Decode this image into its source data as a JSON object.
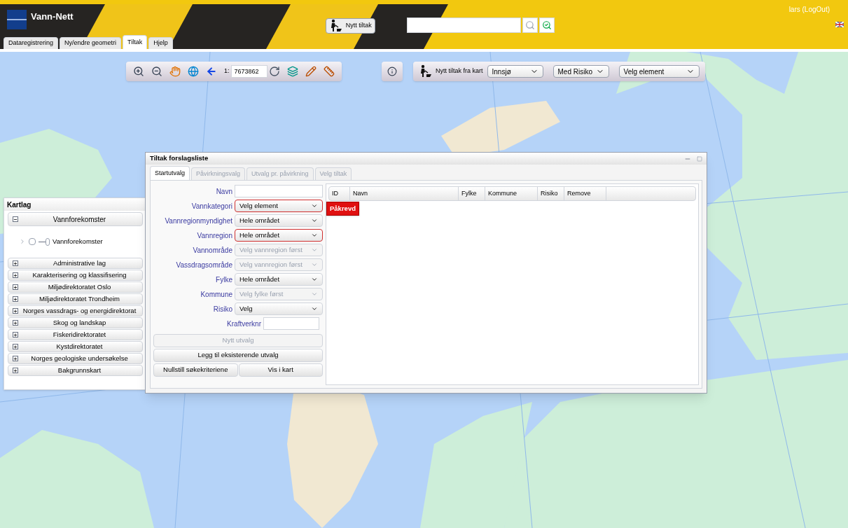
{
  "app": {
    "title": "Vann-Nett"
  },
  "header": {
    "new_measure_button": "Nytt tiltak",
    "user_link": "lars (LogOut)"
  },
  "tabs": [
    {
      "label": "Dataregistrering",
      "selected": false
    },
    {
      "label": "Ny/endre geometri",
      "selected": false
    },
    {
      "label": "Tiltak",
      "selected": true
    },
    {
      "label": "Hjelp",
      "selected": false
    }
  ],
  "map_toolbar": {
    "scale_prefix": "1:",
    "scale": "7673862"
  },
  "measure_toolbar": {
    "button": "Nytt tiltak fra kart",
    "dropdowns": [
      "Innsjø",
      "Med Risiko",
      "Velg element"
    ]
  },
  "layers_panel": {
    "title": "Kartlag",
    "groups": [
      {
        "label": "Vannforekomster",
        "expanded": true,
        "children": [
          {
            "label": "Vannforekomster",
            "checked": false,
            "level": 1
          }
        ]
      },
      {
        "label": "Administrative lag",
        "expanded": false
      },
      {
        "label": "Karakterisering og klassifisering",
        "expanded": false
      },
      {
        "label": "Miljødirektoratet Oslo",
        "expanded": false
      },
      {
        "label": "Miljødirektoratet Trondheim",
        "expanded": false
      },
      {
        "label": "Norges vassdrags- og energidirektorat",
        "expanded": false
      },
      {
        "label": "Skog og landskap",
        "expanded": false
      },
      {
        "label": "Fiskeridirektoratet",
        "expanded": false
      },
      {
        "label": "Kystdirektoratet",
        "expanded": false
      },
      {
        "label": "Norges geologiske undersøkelse",
        "expanded": false
      },
      {
        "label": "Bakgrunnskart",
        "expanded": false
      }
    ]
  },
  "dialog": {
    "title": "Tiltak forslagsliste",
    "tabs": [
      {
        "label": "Startutvalg",
        "selected": true,
        "disabled": false
      },
      {
        "label": "Påvirkningsvalg",
        "selected": false,
        "disabled": true
      },
      {
        "label": "Utvalg pr. påvirkning",
        "selected": false,
        "disabled": true
      },
      {
        "label": "Velg tiltak",
        "selected": false,
        "disabled": true
      }
    ],
    "fields": [
      {
        "label": "Navn",
        "kind": "text"
      },
      {
        "label": "Vannkategori",
        "kind": "select",
        "value": "Velg element",
        "invalid": true,
        "disabled": false
      },
      {
        "label": "Vannregionmyndighet",
        "kind": "select",
        "value": "Hele området",
        "invalid": false,
        "disabled": false
      },
      {
        "label": "Vannregion",
        "kind": "select",
        "value": "Hele området",
        "invalid": true,
        "disabled": false
      },
      {
        "label": "Vannområde",
        "kind": "select",
        "value": "Velg vannregion først",
        "invalid": false,
        "disabled": true
      },
      {
        "label": "Vassdragsområde",
        "kind": "select",
        "value": "Velg vannregion først",
        "invalid": false,
        "disabled": true
      },
      {
        "label": "Fylke",
        "kind": "select",
        "value": "Hele området",
        "invalid": false,
        "disabled": false
      },
      {
        "label": "Kommune",
        "kind": "select",
        "value": "Velg fylke først",
        "invalid": false,
        "disabled": true
      },
      {
        "label": "Risiko",
        "kind": "select",
        "value": "Velg",
        "invalid": false,
        "disabled": false
      },
      {
        "label": "Kraftverknr",
        "kind": "short_text"
      }
    ],
    "button_rows": [
      [
        {
          "label": "Nytt utvalg",
          "disabled": true
        }
      ],
      [
        {
          "label": "Legg til eksisterende utvalg",
          "disabled": false
        }
      ],
      [
        {
          "label": "Nullstill søkekriteriene",
          "disabled": false
        },
        {
          "label": "Vis i kart",
          "disabled": false
        }
      ]
    ],
    "table": {
      "columns": [
        "ID",
        "Navn",
        "Fylke",
        "Kommune",
        "Risiko",
        "Remove"
      ],
      "validation_message": "Påkrevd"
    }
  }
}
